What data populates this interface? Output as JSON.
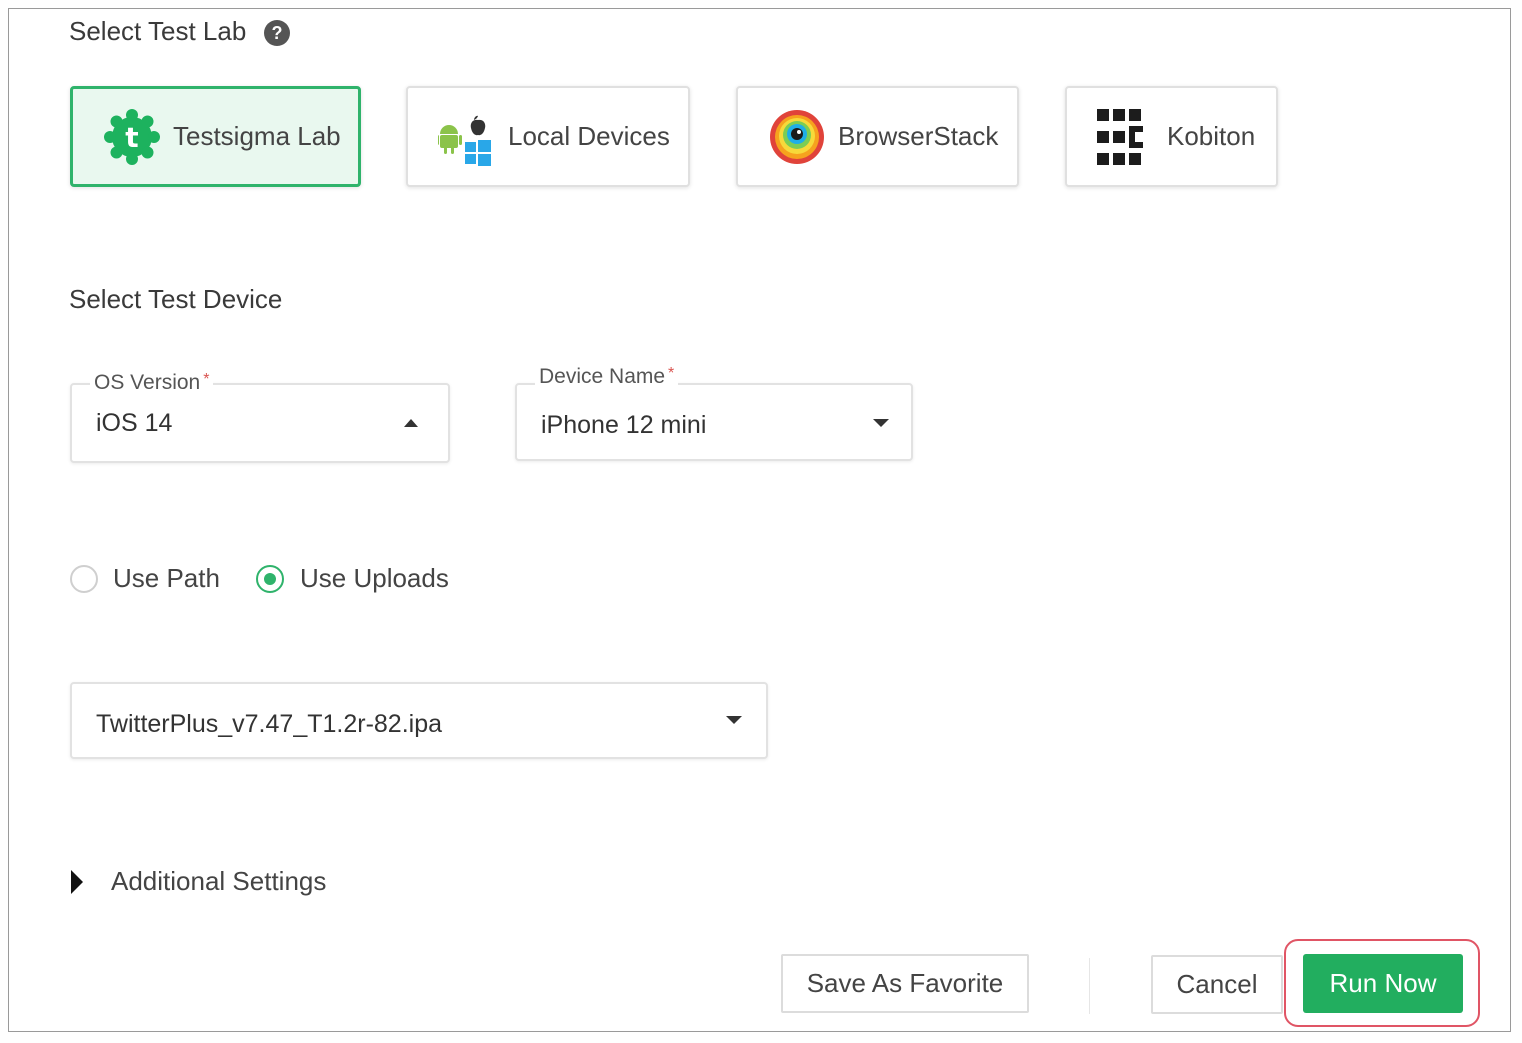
{
  "test_lab": {
    "title": "Select Test Lab",
    "options": [
      {
        "label": "Testsigma Lab",
        "selected": true,
        "icon": "testsigma-gear-icon"
      },
      {
        "label": "Local Devices",
        "selected": false,
        "icon": "android-apple-windows-icon"
      },
      {
        "label": "BrowserStack",
        "selected": false,
        "icon": "browserstack-logo-icon"
      },
      {
        "label": "Kobiton",
        "selected": false,
        "icon": "kobiton-logo-icon"
      }
    ]
  },
  "test_device": {
    "title": "Select Test Device",
    "os_version": {
      "label": "OS Version",
      "required_mark": "*",
      "value": "iOS 14",
      "state": "expanded"
    },
    "device_name": {
      "label": "Device Name",
      "required_mark": "*",
      "value": "iPhone 12 mini",
      "state": "collapsed"
    }
  },
  "app_source": {
    "options": [
      {
        "label": "Use Path",
        "checked": false
      },
      {
        "label": "Use Uploads",
        "checked": true
      }
    ],
    "upload_file": "TwitterPlus_v7.47_T1.2r-82.ipa"
  },
  "additional_settings": {
    "label": "Additional Settings",
    "expanded": false
  },
  "footer": {
    "save_favorite": "Save As Favorite",
    "cancel": "Cancel",
    "run_now": "Run Now"
  },
  "colors": {
    "accent": "#22ae5f",
    "highlight": "#e05565",
    "required": "#d9534f"
  }
}
